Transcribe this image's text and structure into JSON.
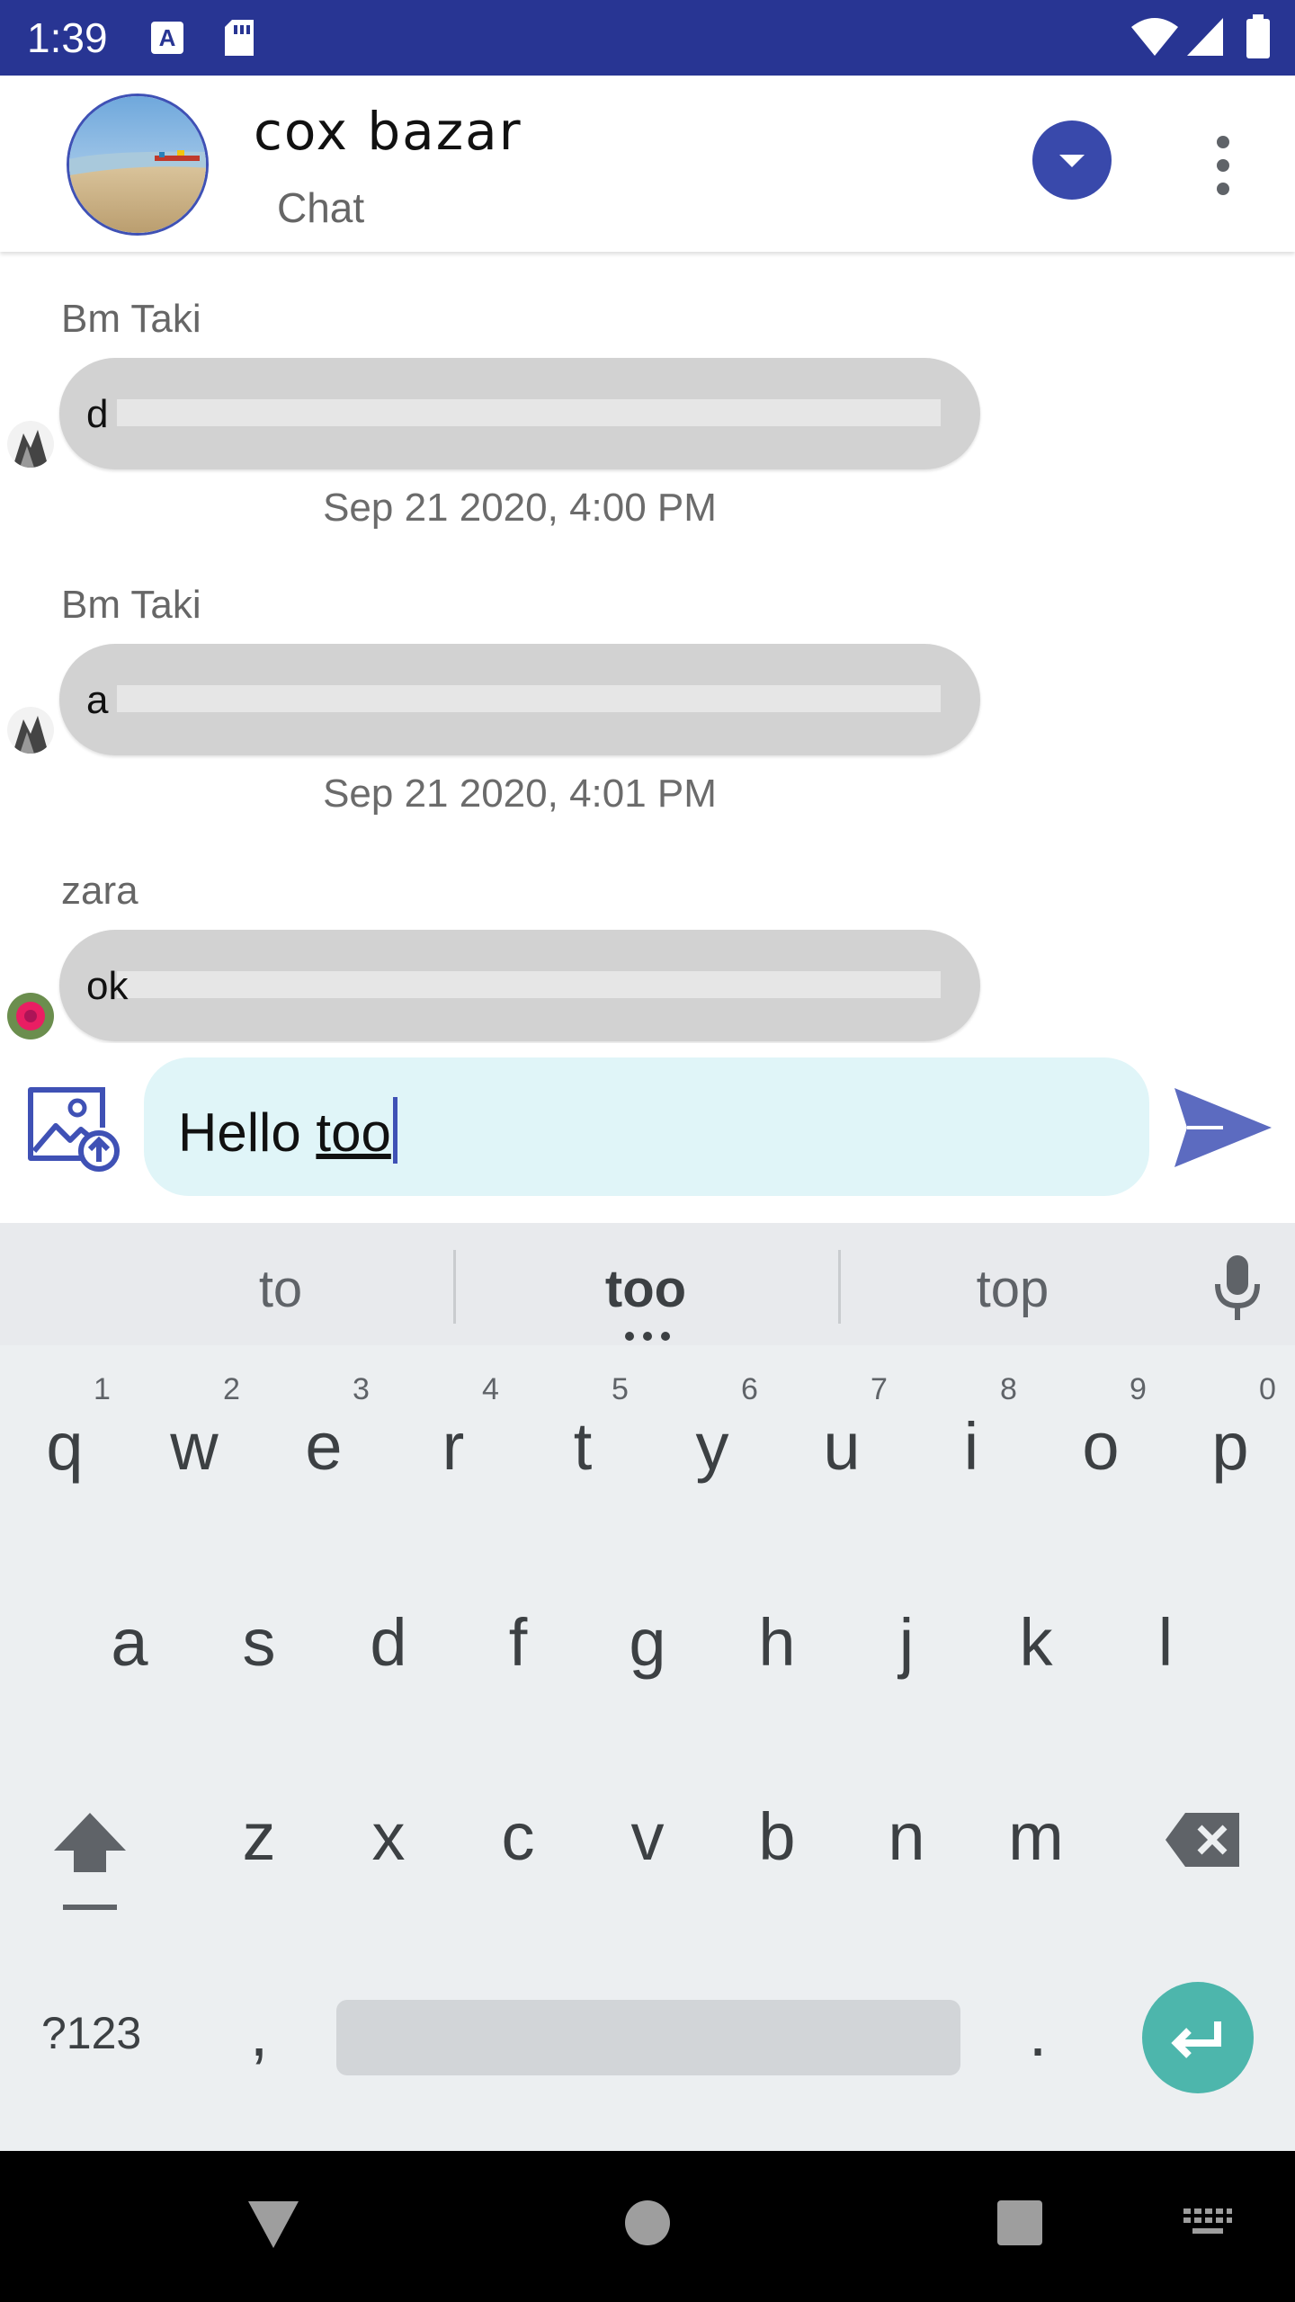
{
  "status_bar": {
    "time": "1:39",
    "icons": [
      "a-notification-icon",
      "sd-card-icon",
      "wifi-icon",
      "signal-icon",
      "battery-icon"
    ]
  },
  "header": {
    "title": "cox bazar",
    "subtitle": "Chat",
    "avatar_icon": "group-photo-beach",
    "dropdown_icon": "chevron-down-icon",
    "menu_icon": "more-vert-icon"
  },
  "messages": [
    {
      "sender": "Bm Taki",
      "text": "d",
      "timestamp": "Sep 21 2020, 4:00 PM",
      "avatar": "bw-avatar"
    },
    {
      "sender": "Bm Taki",
      "text": "a",
      "timestamp": "Sep 21 2020, 4:01 PM",
      "avatar": "bw-avatar"
    },
    {
      "sender": "zara",
      "text": "ok",
      "timestamp": "",
      "avatar": "flower-avatar"
    }
  ],
  "composer": {
    "text_before": "Hello ",
    "text_underlined": "too",
    "attach_icon": "image-upload-icon",
    "send_icon": "send-icon"
  },
  "keyboard": {
    "suggestions": [
      "to",
      "too",
      "top"
    ],
    "mic_icon": "mic-icon",
    "row1": [
      "q",
      "w",
      "e",
      "r",
      "t",
      "y",
      "u",
      "i",
      "o",
      "p"
    ],
    "row1_hints": [
      "1",
      "2",
      "3",
      "4",
      "5",
      "6",
      "7",
      "8",
      "9",
      "0"
    ],
    "row2": [
      "a",
      "s",
      "d",
      "f",
      "g",
      "h",
      "j",
      "k",
      "l"
    ],
    "row3": [
      "z",
      "x",
      "c",
      "v",
      "b",
      "n",
      "m"
    ],
    "symbols_label": "?123",
    "comma": ",",
    "period": ".",
    "shift_icon": "shift-icon",
    "backspace_icon": "backspace-icon",
    "enter_icon": "enter-icon"
  },
  "nav_bar": {
    "back_icon": "back-triangle-icon",
    "home_icon": "home-circle-icon",
    "recents_icon": "recents-square-icon",
    "keyboard_icon": "keyboard-switch-icon"
  },
  "colors": {
    "status_bar": "#283593",
    "accent": "#3949ab",
    "bubble": "#d2d2d2",
    "input_bg": "#e0f5f8",
    "enter_key": "#4db6ac"
  }
}
